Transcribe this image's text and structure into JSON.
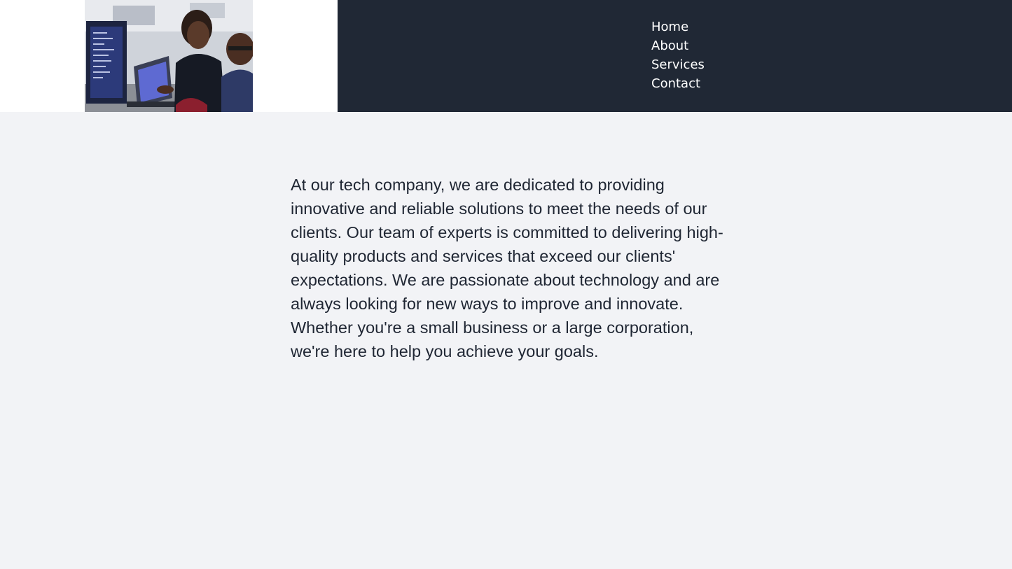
{
  "header": {
    "image": {
      "alt": "",
      "icon": "people-working-at-computers-photo"
    },
    "nav": {
      "items": [
        {
          "label": "Home"
        },
        {
          "label": "About"
        },
        {
          "label": "Services"
        },
        {
          "label": "Contact"
        }
      ]
    }
  },
  "main": {
    "intro": "At our tech company, we are dedicated to providing innovative and reliable solutions to meet the needs of our clients. Our team of experts is committed to delivering high-quality products and services that exceed our clients' expectations. We are passionate about technology and are always looking for new ways to improve and innovate. Whether you're a small business or a large corporation, we're here to help you achieve your goals."
  },
  "colors": {
    "nav_background": "#202835",
    "page_background": "#f2f3f6",
    "text": "#1f2633",
    "nav_text": "#ffffff"
  }
}
